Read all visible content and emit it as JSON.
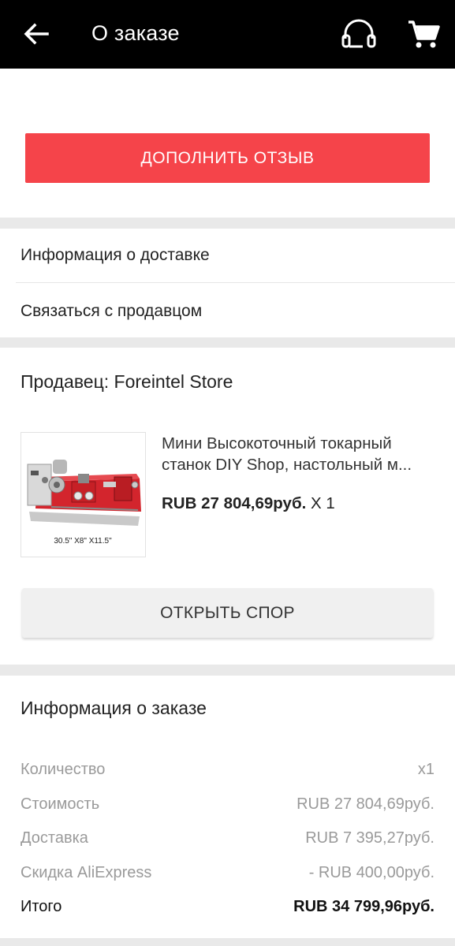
{
  "header": {
    "title": "О заказе",
    "icons": [
      "back-arrow-icon",
      "headset-support-icon",
      "cart-icon"
    ]
  },
  "review": {
    "button_label": "ДОПОЛНИТЬ ОТЗЫВ",
    "button_color": "#f5444a"
  },
  "links": [
    {
      "label": "Информация о доставке"
    },
    {
      "label": "Связаться с продавцом"
    }
  ],
  "seller": {
    "name": "Продавец: Foreintel Store",
    "product": {
      "title_line1": "Мини Высокоточный токарный",
      "title_line2": "станок DIY Shop, настольный м...",
      "price": "RUB 27 804,69руб.",
      "quantity": "X 1",
      "image_caption": "30.5\" X8\" X11.5\""
    },
    "dispute_button_label": "ОТКРЫТЬ СПОР"
  },
  "order_info": {
    "title": "Информация о заказе",
    "rows": [
      {
        "label": "Количество",
        "value": "x1"
      },
      {
        "label": "Стоимость",
        "value": "RUB 27 804,69руб."
      },
      {
        "label": "Доставка",
        "value": "RUB 7 395,27руб."
      },
      {
        "label": "Скидка AliExpress",
        "value": "- RUB 400,00руб."
      },
      {
        "label": "Итого",
        "value": "RUB 34 799,96руб."
      }
    ]
  }
}
